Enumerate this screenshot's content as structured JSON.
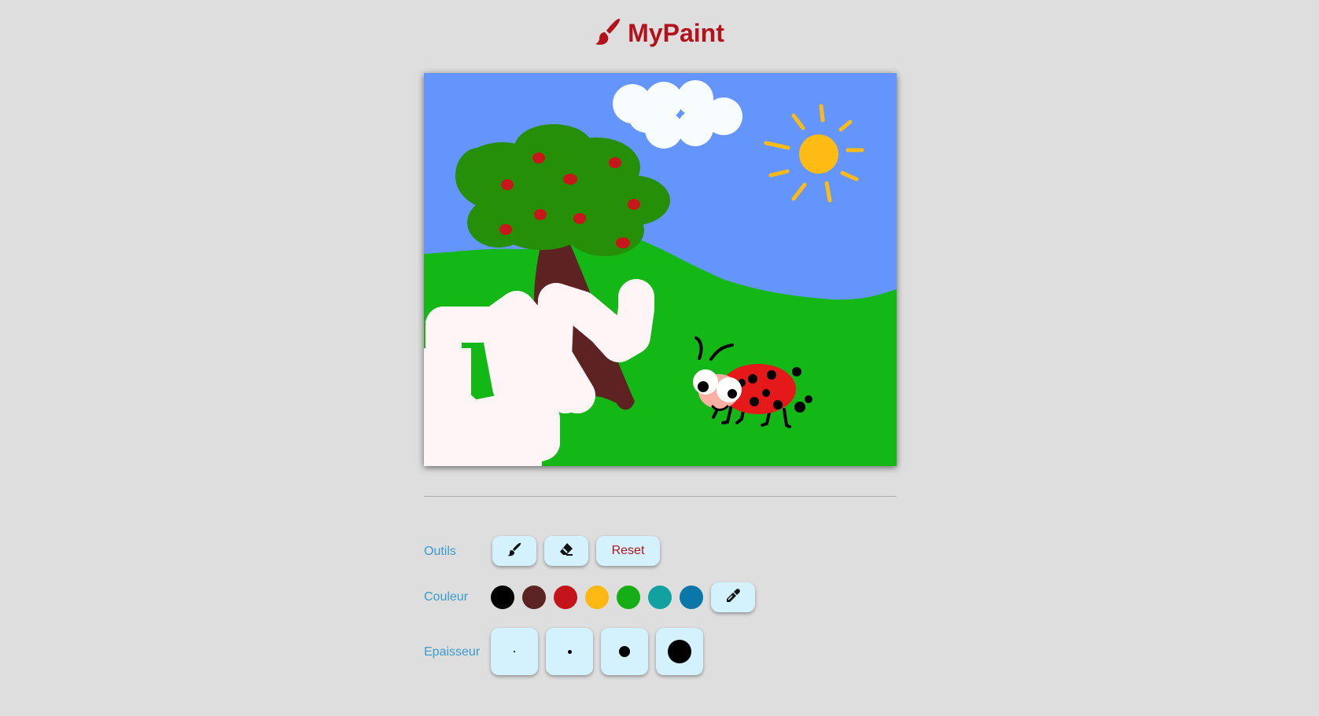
{
  "app": {
    "title": "MyPaint",
    "brand_color": "#b3121c",
    "logo_icon": "paintbrush-icon"
  },
  "canvas": {
    "drawing": "ladybug in a meadow with apple tree, cloud and sun",
    "colors": {
      "sky": "#6495fd",
      "grass": "#13b716",
      "foliage": "#248f07",
      "trunk": "#5e2222",
      "fruit": "#c8161d",
      "sun": "#fdbb14",
      "cloud": "#f7fcfe",
      "paint_stroke": "#fff5f7",
      "ladybug": "#e5181a"
    }
  },
  "toolbar": {
    "tools_label": "Outils",
    "brush_icon": "brush-icon",
    "eraser_icon": "eraser-icon",
    "reset_label": "Reset",
    "color_label": "Couleur",
    "colors": [
      "#000000",
      "#5b2324",
      "#c3141b",
      "#fdb813",
      "#16ad16",
      "#11a1a1",
      "#0978a9"
    ],
    "color_picker_icon": "eyedropper-icon",
    "thickness_label": "Epaisseur",
    "thickness_levels": [
      "extra-small",
      "small",
      "medium",
      "large"
    ]
  }
}
